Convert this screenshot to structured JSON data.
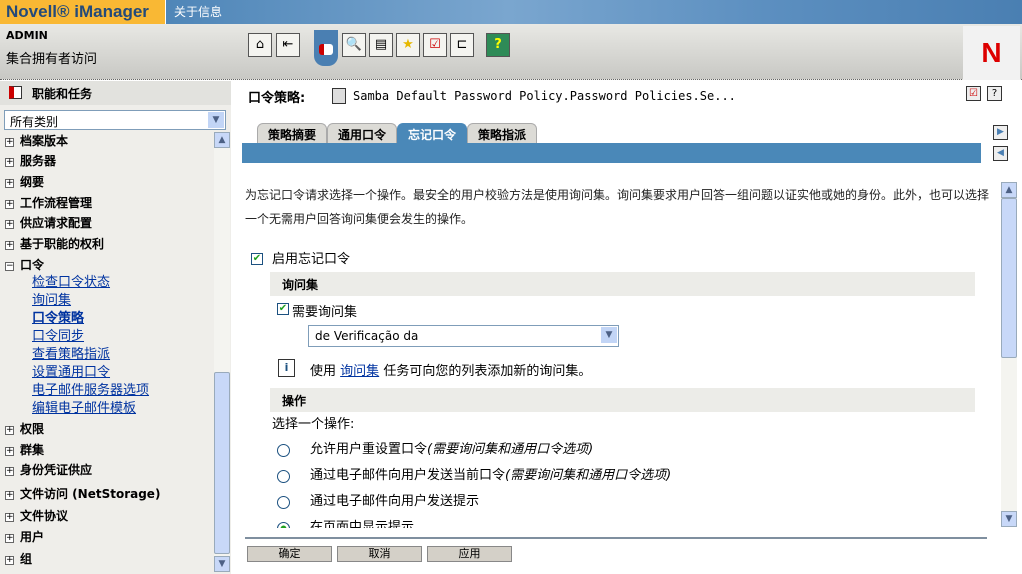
{
  "banner": {
    "logo": "Novell® iManager",
    "about": "关于信息"
  },
  "header": {
    "user": "ADMIN",
    "subtitle": "集合拥有者访问",
    "logo": "N",
    "toolbar": [
      "home-icon",
      "exit-icon",
      "roles-tasks-icon",
      "view-objects-icon",
      "configure-icon",
      "favorites-icon",
      "tasks-list-icon",
      "network-icon",
      "help-icon"
    ]
  },
  "sidebar": {
    "title": "职能和任务",
    "category": "所有类别",
    "groups_top": [
      {
        "label": "档案版本"
      },
      {
        "label": "服务器"
      },
      {
        "label": "纲要"
      },
      {
        "label": "工作流程管理"
      },
      {
        "label": "供应请求配置"
      },
      {
        "label": "基于职能的权利"
      }
    ],
    "expanded": {
      "label": "口令",
      "items": [
        "检查口令状态",
        "询问集",
        "口令策略",
        "口令同步",
        "查看策略指派",
        "设置通用口令",
        "电子邮件服务器选项",
        "编辑电子邮件模板"
      ],
      "current": "口令策略"
    },
    "groups_bottom": [
      {
        "label": "权限"
      },
      {
        "label": "群集"
      },
      {
        "label": "身份凭证供应"
      },
      {
        "label": "文件访问 (NetStorage)"
      },
      {
        "label": "文件协议"
      },
      {
        "label": "用户"
      },
      {
        "label": "组"
      }
    ]
  },
  "main": {
    "title": "口令策略",
    "object": "Samba Default Password Policy.Password Policies.Se...",
    "tabs": [
      "策略摘要",
      "通用口令",
      "忘记口令",
      "策略指派"
    ],
    "active_tab": "忘记口令",
    "description": "为忘记口令请求选择一个操作。最安全的用户校验方法是使用询问集。询问集要求用户回答一组问题以证实他或她的身份。此外，也可以选择一个无需用户回答询问集便会发生的操作。",
    "enable_label": "启用忘记口令",
    "enable_checked": true,
    "section_questions": "询问集",
    "require_label": "需要询问集",
    "require_checked": true,
    "question_set": "de Verificação da",
    "info_pre": "使用",
    "info_link": "询问集",
    "info_post": "任务可向您的列表添加新的询问集。",
    "section_actions": "操作",
    "choose_label": "选择一个操作:",
    "options": [
      {
        "label": "允许用户重设置口令",
        "note": "(需要询问集和通用口令选项)",
        "selected": false
      },
      {
        "label": "通过电子邮件向用户发送当前口令",
        "note": "(需要询问集和通用口令选项)",
        "selected": false
      },
      {
        "label": "通过电子邮件向用户发送提示",
        "note": "",
        "selected": false
      },
      {
        "label": "在页面中显示提示",
        "note": "",
        "selected": true
      }
    ],
    "buttons": {
      "ok": "确定",
      "cancel": "取消",
      "apply": "应用"
    }
  },
  "colors": {
    "accent": "#4a88b8",
    "banner": "#f9b834",
    "link": "#0033a0"
  }
}
